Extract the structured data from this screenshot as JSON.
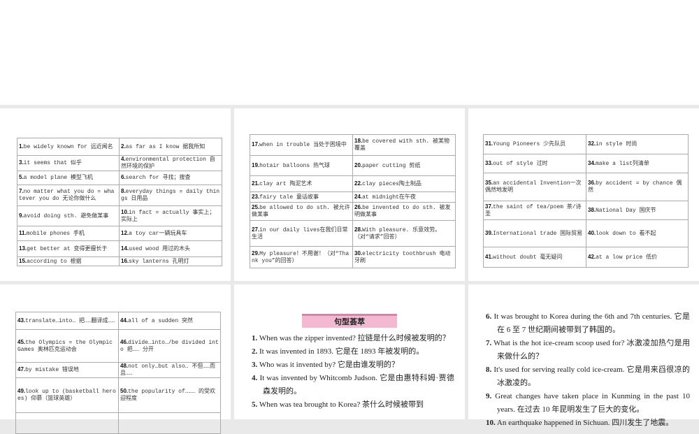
{
  "tables": [
    {
      "rows": [
        [
          {
            "n": "1.",
            "t": "be widely known for 远近闻名"
          },
          {
            "n": "2.",
            "t": "as far as I know 据我所知"
          }
        ],
        [
          {
            "n": "3.",
            "t": "it seems that 似乎"
          },
          {
            "n": "4.",
            "t": "environmental protection 自然环境的保护"
          }
        ],
        [
          {
            "n": "5.",
            "t": "a model plane 模型飞机"
          },
          {
            "n": "6.",
            "t": "search for 寻找；搜查"
          }
        ],
        [
          {
            "n": "7.",
            "t": "no matter what you do = whatever you do 无论你做什么"
          },
          {
            "n": "8.",
            "t": "everyday things = daily things 日用品"
          }
        ],
        [
          {
            "n": "9.",
            "t": "avoid doing sth. 避免做某事"
          },
          {
            "n": "10.",
            "t": "in fact = actually 事实上；实际上"
          }
        ],
        [
          {
            "n": "11.",
            "t": "mobile phones 手机"
          },
          {
            "n": "12.",
            "t": "a toy car一辆玩具车"
          }
        ],
        [
          {
            "n": "13.",
            "t": "get better at 变得更擅长于"
          },
          {
            "n": "14.",
            "t": "used wood 用过的木头"
          }
        ],
        [
          {
            "n": "15.",
            "t": "according to 根据"
          },
          {
            "n": "16.",
            "t": "sky lanterns 孔明灯"
          }
        ]
      ]
    },
    {
      "rows": [
        [
          {
            "n": "17.",
            "t": "when in trouble 当处于困境中"
          },
          {
            "n": "18.",
            "t": "be covered with sth. 被某物覆盖"
          }
        ],
        [
          {
            "n": "19.",
            "t": "hotair balloons 热气球"
          },
          {
            "n": "20.",
            "t": "paper cutting 剪纸"
          }
        ],
        [
          {
            "n": "21.",
            "t": "clay art 陶泥艺术"
          },
          {
            "n": "22.",
            "t": "clay pieces陶土制品"
          }
        ],
        [
          {
            "n": "23.",
            "t": "fairy tale 童话故事"
          },
          {
            "n": "24.",
            "t": "at midnight在午夜"
          }
        ],
        [
          {
            "n": "25.",
            "t": "be allowed to do sth. 被允许做某事"
          },
          {
            "n": "26.",
            "t": "be invented to do sth. 被发明做某事"
          }
        ],
        [
          {
            "n": "27.",
            "t": "in our daily lives在我们日常生活"
          },
          {
            "n": "28.",
            "t": "With pleasure. 乐意效劳。（对“请求”回答）"
          }
        ],
        [
          {
            "n": "29.",
            "t": "My pleasure！不用谢！（对“Thank you”的回答）"
          },
          {
            "n": "30.",
            "t": "electricity toothbrush 电动牙刷"
          }
        ]
      ]
    },
    {
      "rows": [
        [
          {
            "n": "31.",
            "t": "Young Pioneers 少先队员"
          },
          {
            "n": "32.",
            "t": "in style 时尚"
          }
        ],
        [
          {
            "n": "33.",
            "t": "out of style 过时"
          },
          {
            "n": "34.",
            "t": "make a list列清单"
          }
        ],
        [
          {
            "n": "35.",
            "t": "an accidental Invention一次偶然地发明"
          },
          {
            "n": "36.",
            "t": "by accident = by chance 偶然"
          }
        ],
        [
          {
            "n": "37.",
            "t": "the saint of tea/poem 茶/诗圣"
          },
          {
            "n": "38.",
            "t": "National Day 国庆节"
          }
        ],
        [
          {
            "n": "39.",
            "t": "International trade 国际贸易"
          },
          {
            "n": "40.",
            "t": "look down to 看不起"
          }
        ],
        [
          {
            "n": "41.",
            "t": "without doubt 毫无疑问"
          },
          {
            "n": "42.",
            "t": "at a low price 低价"
          }
        ]
      ]
    },
    {
      "rows": [
        [
          {
            "n": "43.",
            "t": "translate…into… 把……翻译成……"
          },
          {
            "n": "44.",
            "t": "all of a sudden 突然"
          }
        ],
        [
          {
            "n": "45.",
            "t": "the Olympics = the Olympic Games 奥林匹克运动会"
          },
          {
            "n": "46.",
            "t": "divide…into…/be divided into 把…… 分开"
          }
        ],
        [
          {
            "n": "47.",
            "t": "by mistake 错误地"
          },
          {
            "n": "48.",
            "t": "not only…but also… 不但……而且……"
          }
        ],
        [
          {
            "n": "49.",
            "t": "look up to (basketball heroes) 仰慕（篮球英雄）"
          },
          {
            "n": "50.",
            "t": "the popularity of……… 的受欢迎程度"
          }
        ],
        [
          {
            "n": "",
            "t": ""
          },
          {
            "n": "",
            "t": ""
          }
        ]
      ]
    }
  ],
  "sentences": {
    "banner": "句型荟萃",
    "left": [
      {
        "n": "1.",
        "t": "When was the zipper invented? 拉链是什么时候被发明的？"
      },
      {
        "n": "2.",
        "t": "It was invented in 1893. 它是在 1893 年被发明的。"
      },
      {
        "n": "3.",
        "t": "Who was it invented by? 它是由谁发明的？"
      },
      {
        "n": "4.",
        "t": "It was invented by Whitcomb Judson. 它是由惠特科姆·贾德森发明的。"
      },
      {
        "n": "5.",
        "t": "When was tea brought to Korea? 茶什么时候被带到"
      }
    ],
    "right": [
      {
        "n": "6.",
        "t": "It was brought to Korea during the 6th and 7th centuries. 它是在 6 至 7 世纪期间被带到了韩国的。"
      },
      {
        "n": "7.",
        "t": "What is the hot ice-cream scoop used for? 冰激凌加热勺是用来做什么的？"
      },
      {
        "n": "8.",
        "t": "It's used for serving really cold ice-cream. 它是用来舀很凉的冰激凌的。"
      },
      {
        "n": "9.",
        "t": "Great changes have taken place in Kunming in the past 10 years. 在过去 10 年昆明发生了巨大的变化。"
      },
      {
        "n": "10.",
        "t": "An earthquake happened in Sichuan. 四川发生了地震。"
      }
    ]
  }
}
